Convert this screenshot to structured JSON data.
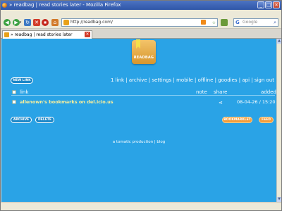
{
  "window": {
    "title": "» readbag | read stories later - Mozilla Firefox"
  },
  "browser": {
    "url": "http://readbag.com/",
    "search_placeholder": "Google",
    "tab_title": "» readbag | read stories later"
  },
  "page": {
    "logo_text": "READBAG",
    "new_link_button": "NEW LINK",
    "nav_links": "1 link | archive | settings | mobile | offline | goodies | api | sign out",
    "table": {
      "col_link": "link",
      "col_note": "note",
      "col_share": "share",
      "col_added": "added",
      "rows": [
        {
          "title": "allenown's bookmarks on del.icio.us",
          "added": "08-04-26 / 15:20"
        }
      ]
    },
    "archive_button": "ARCHIVE",
    "delete_button": "DELETE",
    "bookmarklet_button": "BOOKMARKLET",
    "feed_button": "FEED",
    "footer": "a tomatic production | blog"
  },
  "colors": {
    "page_bg": "#2aa3e6",
    "link_text": "#fff19a",
    "accent_orange": "#f39d3d"
  }
}
